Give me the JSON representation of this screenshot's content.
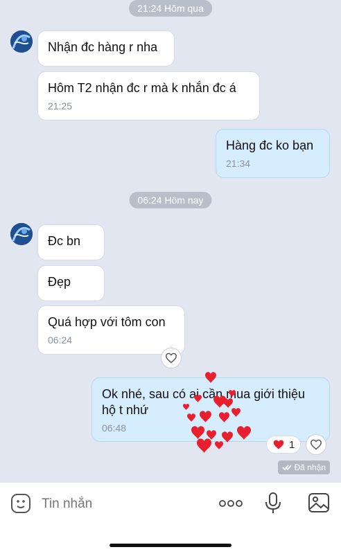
{
  "chat": {
    "separator_yesterday": "21:24 Hôm qua",
    "separator_today": "06:24 Hôm nay",
    "messages": [
      {
        "text": "Nhận đc hàng r nha"
      },
      {
        "text": "Hôm T2 nhận đc r mà k nhắn đc á",
        "time": "21:25"
      },
      {
        "text": "Hàng đc ko bạn",
        "time": "21:34"
      },
      {
        "text": "Đc bn"
      },
      {
        "text": "Đẹp"
      },
      {
        "text": "Quá  hợp với tôm con",
        "time": "06:24"
      },
      {
        "text": "Ok nhé, sau có ai cần mua giới thiệu hộ t nhứ",
        "time": "06:48"
      }
    ],
    "reaction_count": "1",
    "seen_label": "Đã nhận"
  },
  "input": {
    "placeholder": "Tin nhắn"
  },
  "colors": {
    "background": "#e2e6f0",
    "incoming_bubble": "#ffffff",
    "outgoing_bubble": "#d6ecff",
    "heart": "#e8202e"
  },
  "icons": [
    "avatar",
    "heart-outline-icon",
    "heart-filled-icon",
    "double-check-icon",
    "sticker-icon",
    "more-dots-icon",
    "microphone-icon",
    "image-icon"
  ]
}
